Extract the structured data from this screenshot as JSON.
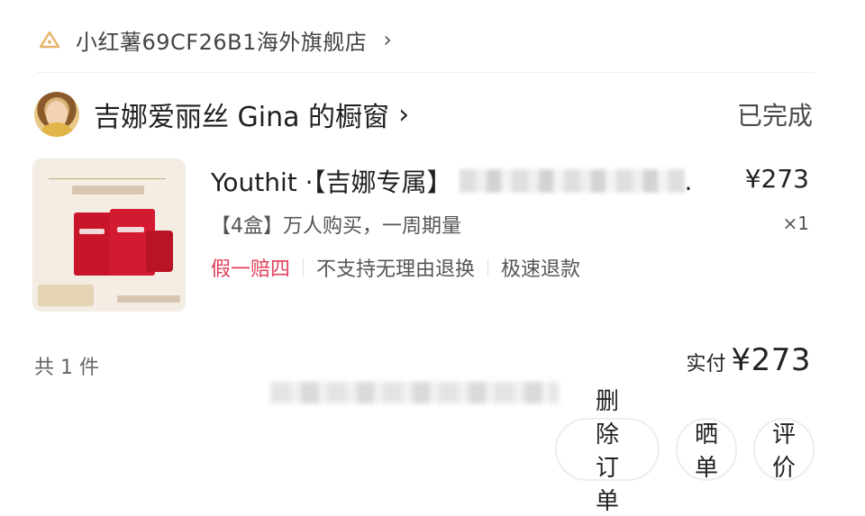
{
  "store": {
    "icon": "xiaohongshu-shop-icon",
    "name": "小红薯69CF26B1海外旗舰店",
    "chevron": "›"
  },
  "shop": {
    "avatar": "avatar",
    "name": "吉娜爱丽丝 Gina 的橱窗",
    "chevron": "›",
    "status": "已完成"
  },
  "product": {
    "title_prefix": "Youthit ·【吉娜专属】",
    "title_suffix": ".",
    "price": "¥273",
    "variant": "【4盒】万人购买，一周期量",
    "qty": "×1",
    "tags": [
      "假一赔四",
      "不支持无理由退换",
      "极速退款"
    ]
  },
  "summary": {
    "count": "共 1 件",
    "paid_label": "实付",
    "paid_amount": "¥273"
  },
  "actions": {
    "delete": "删除订单",
    "share": "晒单",
    "review": "评价"
  },
  "colors": {
    "accent_red": "#e0415a",
    "text": "#222222",
    "muted": "#666666"
  }
}
